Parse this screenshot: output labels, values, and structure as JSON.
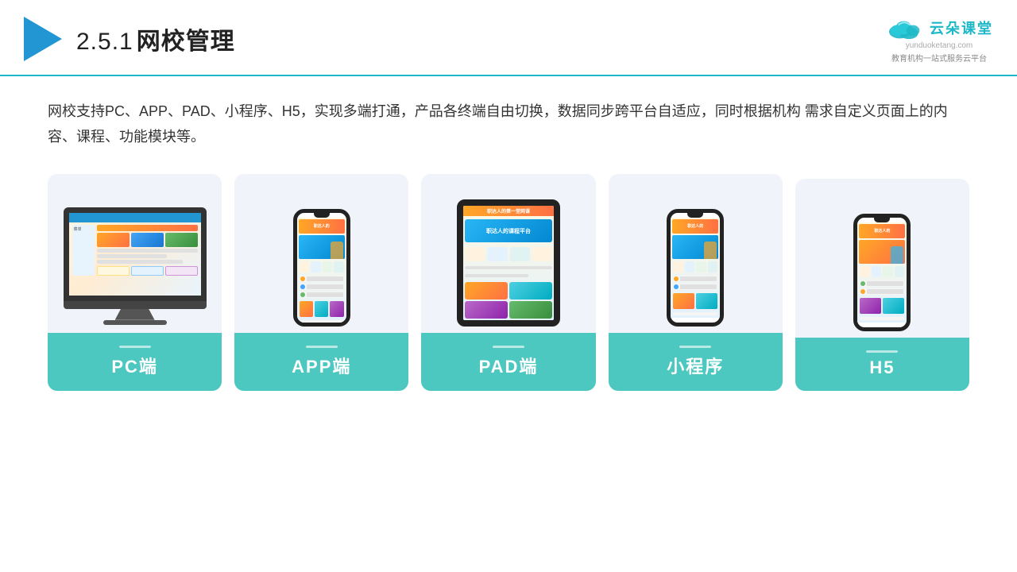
{
  "header": {
    "section_num": "2.5.1",
    "title": "网校管理",
    "logo_cn": "云朵课堂",
    "logo_url": "yunduoketang.com",
    "logo_sub": "教育机构一站\n式服务云平台"
  },
  "description": "网校支持PC、APP、PAD、小程序、H5，实现多端打通，产品各终端自由切换，数据同步跨平台自适应，同时根据机构\n需求自定义页面上的内容、课程、功能模块等。",
  "cards": [
    {
      "id": "pc",
      "label": "PC端"
    },
    {
      "id": "app",
      "label": "APP端"
    },
    {
      "id": "pad",
      "label": "PAD端"
    },
    {
      "id": "miniprogram",
      "label": "小程序"
    },
    {
      "id": "h5",
      "label": "H5"
    }
  ],
  "colors": {
    "accent": "#1db8c8",
    "card_label_bg": "#4dc8c0",
    "header_border": "#1db8c8"
  }
}
